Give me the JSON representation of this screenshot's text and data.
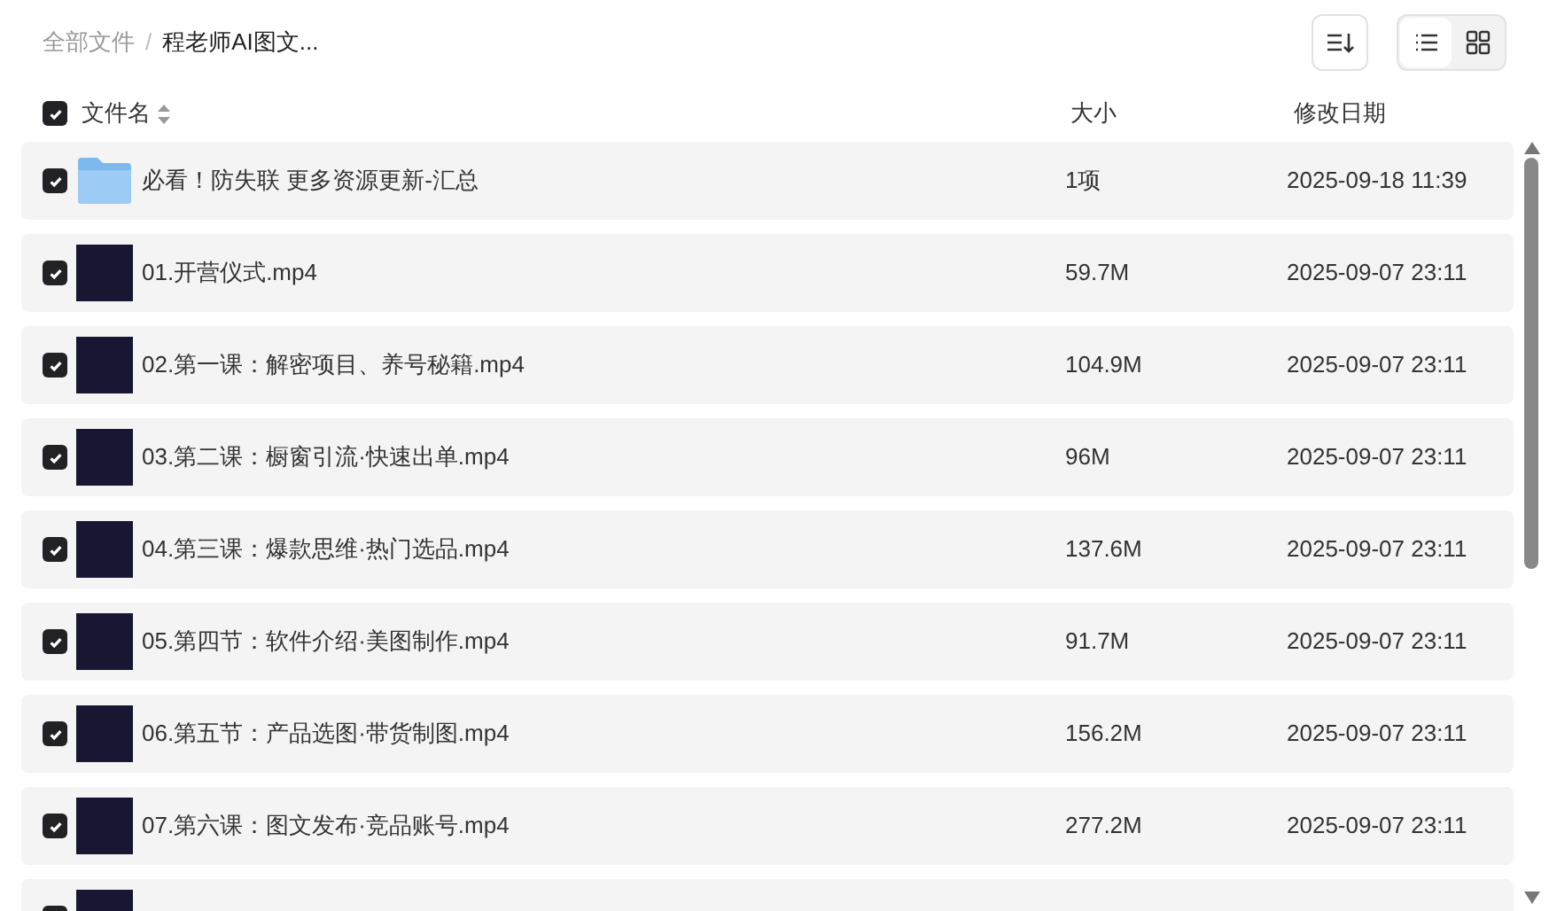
{
  "breadcrumb_separator": "/",
  "breadcrumb": [
    {
      "label": "全部文件",
      "current": false
    },
    {
      "label": "程老师AI图文...",
      "current": true
    }
  ],
  "view_modes": [
    {
      "kind": "list",
      "selected": true
    },
    {
      "kind": "grid",
      "selected": false
    }
  ],
  "header": {
    "checked": true,
    "columns": [
      "文件名",
      "大小",
      "修改日期"
    ]
  },
  "rows": [
    {
      "kind": "folder",
      "checked": true,
      "name": "必看！防失联 更多资源更新-汇总",
      "size": "1项",
      "date": "2025-09-18 11:39"
    },
    {
      "kind": "video",
      "checked": true,
      "name": "01.开营仪式.mp4",
      "size": "59.7M",
      "date": "2025-09-07 23:11"
    },
    {
      "kind": "video",
      "checked": true,
      "name": "02.第一课：解密项目、养号秘籍.mp4",
      "size": "104.9M",
      "date": "2025-09-07 23:11"
    },
    {
      "kind": "video",
      "checked": true,
      "name": "03.第二课：橱窗引流·快速出单.mp4",
      "size": "96M",
      "date": "2025-09-07 23:11"
    },
    {
      "kind": "video",
      "checked": true,
      "name": "04.第三课：爆款思维·热门选品.mp4",
      "size": "137.6M",
      "date": "2025-09-07 23:11"
    },
    {
      "kind": "video",
      "checked": true,
      "name": "05.第四节：软件介绍·美图制作.mp4",
      "size": "91.7M",
      "date": "2025-09-07 23:11"
    },
    {
      "kind": "video",
      "checked": true,
      "name": "06.第五节：产品选图·带货制图.mp4",
      "size": "156.2M",
      "date": "2025-09-07 23:11"
    },
    {
      "kind": "video",
      "checked": true,
      "name": "07.第六课：图文发布·竞品账号.mp4",
      "size": "277.2M",
      "date": "2025-09-07 23:11"
    },
    {
      "kind": "video",
      "checked": true
    }
  ]
}
